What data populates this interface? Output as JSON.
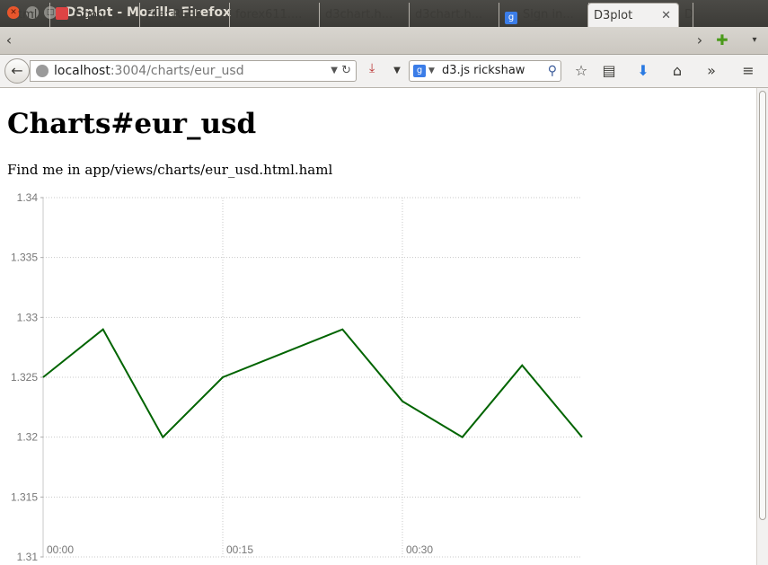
{
  "window": {
    "title": "D3plot - Mozilla Firefox"
  },
  "tabs": [
    {
      "label": "tml",
      "favicon": "none"
    },
    {
      "label": "Googl...",
      "favicon": "doc-icon"
    },
    {
      "label": "File: REFE...",
      "favicon": "none"
    },
    {
      "label": "forex611....",
      "favicon": "none"
    },
    {
      "label": "d3chart.h...",
      "favicon": "none"
    },
    {
      "label": "d3chart.h...",
      "favicon": "none"
    },
    {
      "label": "Sign in...",
      "favicon": "google-icon"
    },
    {
      "label": "D3plot",
      "favicon": "none",
      "active": true
    },
    {
      "label": "D",
      "favicon": "none"
    }
  ],
  "navbar": {
    "url_host": "localhost",
    "url_path": ":3004/charts/eur_usd",
    "search_value": "d3.js rickshaw",
    "search_engine": "g"
  },
  "page": {
    "heading": "Charts#eur_usd",
    "hint": "Find me in app/views/charts/eur_usd.html.haml"
  },
  "chart_data": {
    "type": "line",
    "x_ticks": [
      "00:00",
      "00:15",
      "00:30"
    ],
    "y_ticks": [
      "1.34",
      "1.335",
      "1.33",
      "1.325",
      "1.32",
      "1.315",
      "1.31"
    ],
    "ylim": [
      1.31,
      1.34
    ],
    "series": [
      {
        "color": "#006400",
        "values": [
          1.325,
          1.329,
          1.32,
          1.325,
          1.327,
          1.329,
          1.323,
          1.32,
          1.326,
          1.32
        ]
      }
    ],
    "grid": true
  }
}
